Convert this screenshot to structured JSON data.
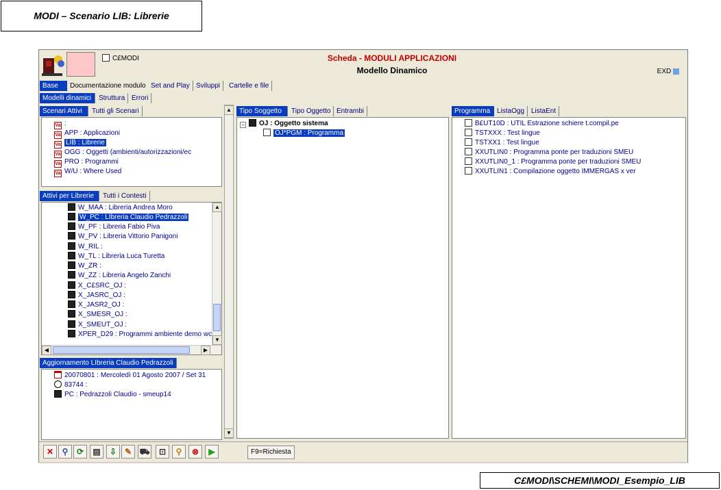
{
  "captions": {
    "top": "MODI – Scenario LIB: Librerie",
    "bottom": "C£MODI\\SCHEMI\\MODI_Esempio_LIB"
  },
  "header": {
    "app_label": "C£MODI",
    "title_line1": "Scheda - MODULI APPLICAZIONI",
    "title_line2": "Modello Dinamico",
    "exd": "EXD"
  },
  "top_tabs": [
    "Base",
    "Documentazione modulo",
    "Set and Play",
    "Sviluppi",
    "Cartelle e file"
  ],
  "sub_tabs": [
    "Modelli dinamici",
    "Struttura",
    "Errori"
  ],
  "scenari": {
    "tabs": [
      "Scenari Attivi",
      "Tutti gli Scenari"
    ],
    "items": [
      {
        "text": ":"
      },
      {
        "text": "APP  : Applicazioni"
      },
      {
        "text": "LIB  : Librerie"
      },
      {
        "text": "OGG  : Oggetti (ambienti/autorizzazioni/ec"
      },
      {
        "text": "PRO  : Programmi"
      },
      {
        "text": "W/U  : Where Used"
      }
    ]
  },
  "librerie": {
    "tabs": [
      "Attivi per Librerie",
      "Tutti i Contesti"
    ],
    "items": [
      {
        "text": "W_MAA  : Libreria Andrea Moro"
      },
      {
        "text": "W_PC  : LIbreria Claudio Pedrazzoli"
      },
      {
        "text": "W_PF  : Libreria Fabio Piva"
      },
      {
        "text": "W_PV  : Libreria Vittorio Panigoni"
      },
      {
        "text": "W_RIL  :"
      },
      {
        "text": "W_TL  : Libreria Luca Turetta"
      },
      {
        "text": "W_ZR  :"
      },
      {
        "text": "W_ZZ  : Libreria Angelo Zanchi"
      },
      {
        "text": "X_C£SRC_OJ  :"
      },
      {
        "text": "X_JASRC_OJ  :"
      },
      {
        "text": "X_JASR2_OJ  :"
      },
      {
        "text": "X_SMESR_OJ  :"
      },
      {
        "text": "X_SMEUT_OJ  :"
      },
      {
        "text": "XPER_D29  : Programmi ambiente demo wc"
      }
    ]
  },
  "aggiornamento": {
    "tab": "Aggiornamento LIbreria Claudio Pedrazzoli",
    "items": [
      {
        "text": "20070801  : Mercoledì 01 Agosto 2007 / Set 31"
      },
      {
        "text": "83744  :"
      },
      {
        "text": "PC  : Pedrazzoli Claudio - smeup14"
      }
    ]
  },
  "tipo": {
    "tabs": [
      "Tipo Soggetto",
      "Tipo Oggetto",
      "Entrambi"
    ],
    "root": "OJ  : Oggetto sistema",
    "child": "OJ*PGM  : Programma"
  },
  "programma": {
    "tabs": [
      "Programma",
      "ListaOgg",
      "ListaEnt"
    ],
    "items": [
      {
        "text": "B£UT10D  : UTIL Estrazione schiere t.compil.pe"
      },
      {
        "text": "TSTXXX  : Test lingue"
      },
      {
        "text": "TSTXX1  : Test lingue"
      },
      {
        "text": "XXUTLIN0  : Programma ponte per traduzioni SMEU"
      },
      {
        "text": "XXUTLIN0_1  : Programma ponte per traduzioni SMEU"
      },
      {
        "text": "XXUTLIN1  : Compilazione oggetto IMMERGAS x ver"
      }
    ]
  },
  "toolbar": {
    "f9": "F9=Richiesta",
    "buttons": [
      "close-icon",
      "zoom-icon",
      "refresh-icon",
      "print-icon",
      "export-icon",
      "edit-icon",
      "cart-icon",
      "select-icon",
      "search-icon",
      "stop-icon",
      "play-icon"
    ]
  },
  "colors": {
    "selection": "#0a3cbe",
    "link": "#00008b",
    "title_red": "#c00000"
  }
}
